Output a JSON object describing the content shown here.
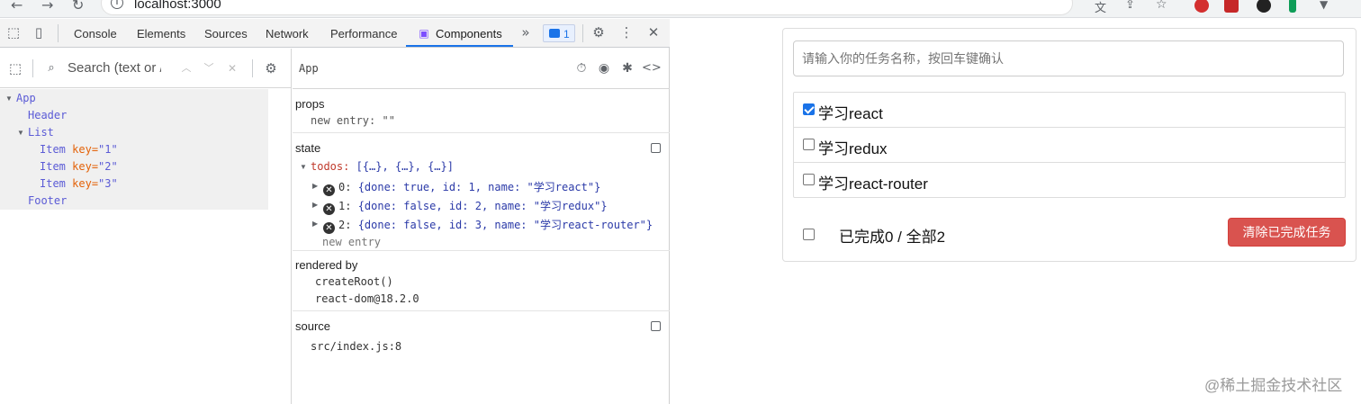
{
  "browser": {
    "url": "localhost:3000"
  },
  "devtools": {
    "tabs": [
      "Console",
      "Elements",
      "Sources",
      "Network",
      "Performance",
      "Components"
    ],
    "active_tab": "Components",
    "issues_count": "1",
    "search_placeholder": "Search (text or /regex/)",
    "tree": {
      "root": "App",
      "header": "Header",
      "list": "List",
      "items": [
        {
          "name": "Item",
          "key_attr": "key=",
          "key_val": "\"1\""
        },
        {
          "name": "Item",
          "key_attr": "key=",
          "key_val": "\"2\""
        },
        {
          "name": "Item",
          "key_attr": "key=",
          "key_val": "\"3\""
        }
      ],
      "footer": "Footer"
    },
    "selected_component": "App",
    "props": {
      "title": "props",
      "new_entry_label": "new entry:",
      "new_entry_value": "\"\""
    },
    "state": {
      "title": "state",
      "todos_key": "todos:",
      "todos_summary": "[{…}, {…}, {…}]",
      "rows": [
        {
          "index": "0:",
          "value": "{done: true, id: 1, name: \"学习react\"}"
        },
        {
          "index": "1:",
          "value": "{done: false, id: 2, name: \"学习redux\"}"
        },
        {
          "index": "2:",
          "value": "{done: false, id: 3, name: \"学习react-router\"}"
        }
      ],
      "new_entry": "new entry"
    },
    "rendered_by": {
      "title": "rendered by",
      "lines": [
        "createRoot()",
        "react-dom@18.2.0"
      ]
    },
    "source": {
      "title": "source",
      "file": "src/index.js:8"
    }
  },
  "app": {
    "input_placeholder": "请输入你的任务名称，按回车键确认",
    "todos": [
      {
        "label": "学习react",
        "done": true
      },
      {
        "label": "学习redux",
        "done": false
      },
      {
        "label": "学习react-router",
        "done": false
      }
    ],
    "footer_text": "已完成0 / 全部2",
    "clear_button": "清除已完成任务"
  },
  "watermark": "@稀土掘金技术社区"
}
